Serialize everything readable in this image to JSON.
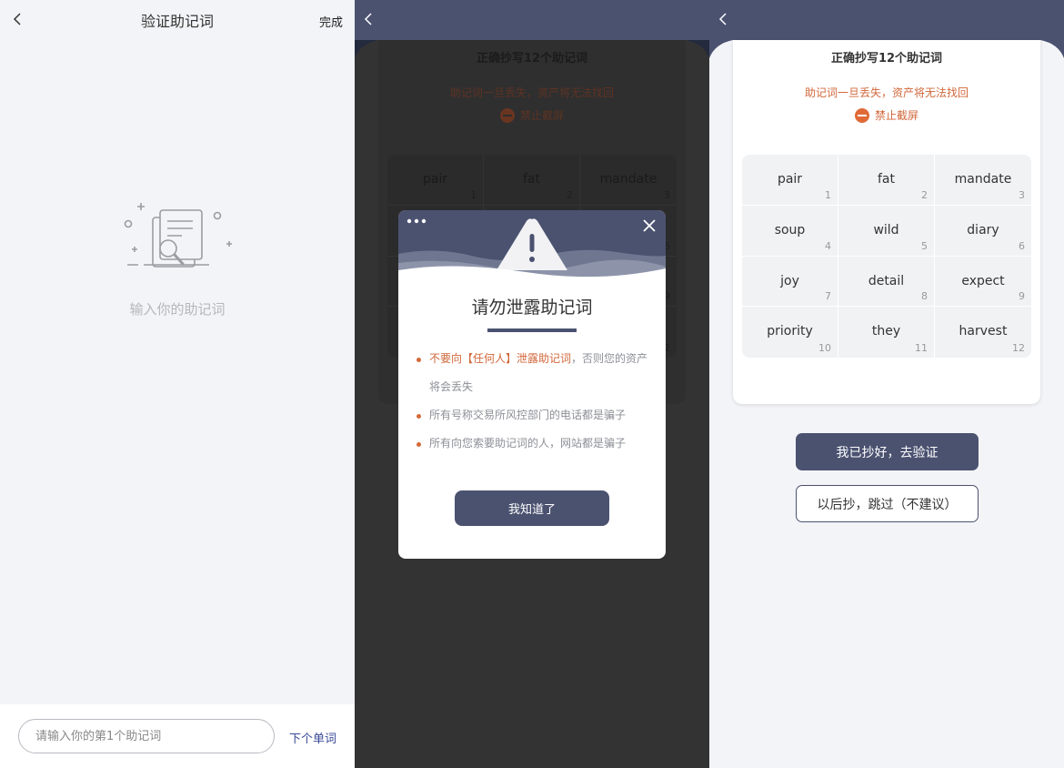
{
  "verify": {
    "title": "验证助记词",
    "done": "完成",
    "empty_text": "输入你的助记词",
    "input_placeholder": "请输入你的第1个助记词",
    "next": "下个单词"
  },
  "backup": {
    "title": "正确抄写12个助记词",
    "warning": "助记词一旦丢失，资产将无法找回",
    "no_screenshot": "禁止截屏",
    "words": [
      {
        "word": "pair",
        "index": "1"
      },
      {
        "word": "fat",
        "index": "2"
      },
      {
        "word": "mandate",
        "index": "3"
      },
      {
        "word": "soup",
        "index": "4"
      },
      {
        "word": "wild",
        "index": "5"
      },
      {
        "word": "diary",
        "index": "6"
      },
      {
        "word": "joy",
        "index": "7"
      },
      {
        "word": "detail",
        "index": "8"
      },
      {
        "word": "expect",
        "index": "9"
      },
      {
        "word": "priority",
        "index": "10"
      },
      {
        "word": "they",
        "index": "11"
      },
      {
        "word": "harvest",
        "index": "12"
      }
    ],
    "confirm_button": "我已抄好，去验证",
    "skip_button": "以后抄，跳过（不建议）"
  },
  "modal": {
    "title": "请勿泄露助记词",
    "bullet1_highlight": "不要向【任何人】泄露助记词",
    "bullet1_rest": "，否则您的资产将会丢失",
    "bullet2": "所有号称交易所风控部门的电话都是骗子",
    "bullet3": "所有向您索要助记词的人，网站都是骗子",
    "button": "我知道了"
  },
  "colors": {
    "brand": "#4b5270",
    "warning": "#d1673a",
    "background": "#f3f4f7",
    "overlay": "#333334"
  }
}
